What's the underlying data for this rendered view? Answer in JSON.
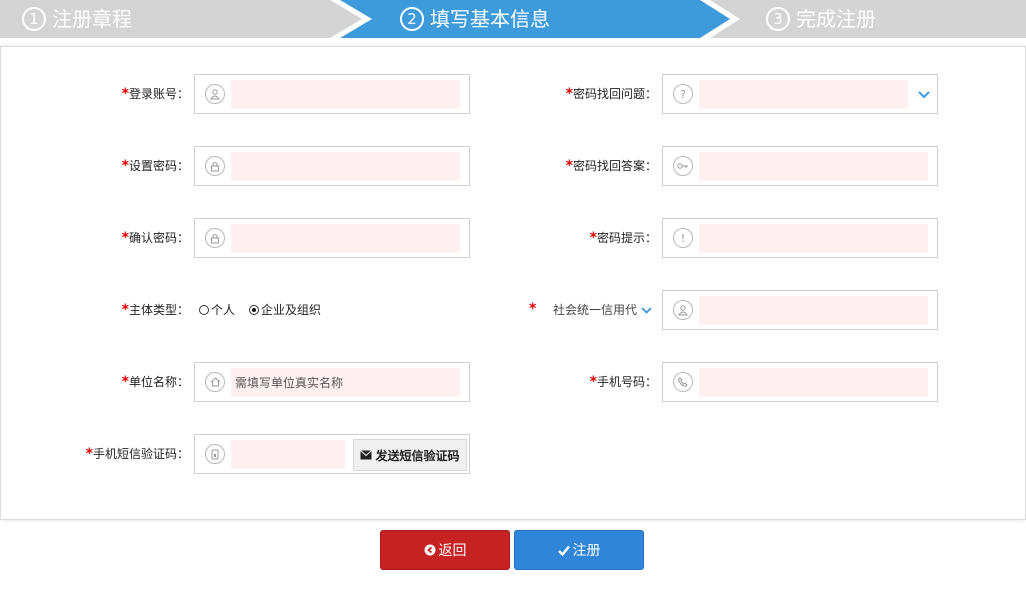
{
  "steps": [
    {
      "num": "1",
      "label": "注册章程",
      "state": "done"
    },
    {
      "num": "2",
      "label": "填写基本信息",
      "state": "active"
    },
    {
      "num": "3",
      "label": "完成注册",
      "state": "todo"
    }
  ],
  "colors": {
    "step_active": "#3d9bdc",
    "step_inactive": "#d4d4d4",
    "required": "#e00000",
    "input_bg": "#fff1f1",
    "btn_back": "#c62223",
    "btn_register": "#2f86d8"
  },
  "form": {
    "required_mark": "*",
    "login_account": {
      "label": "登录账号：",
      "value": "",
      "icon": "user-icon"
    },
    "set_password": {
      "label": "设置密码：",
      "value": "",
      "icon": "lock-icon"
    },
    "confirm_password": {
      "label": "确认密码：",
      "value": "",
      "icon": "lock-icon"
    },
    "subject_type": {
      "label": "主体类型：",
      "options": [
        "个人",
        "企业及组织"
      ],
      "selected": "企业及组织"
    },
    "org_name": {
      "label": "单位名称：",
      "placeholder": "需填写单位真实名称",
      "icon": "home-icon"
    },
    "sms_code": {
      "label": "手机短信验证码：",
      "value": "",
      "icon": "phone-card-icon",
      "send_button": "发送短信验证码"
    },
    "security_question": {
      "label": "密码找回问题：",
      "value": "",
      "icon": "question-icon"
    },
    "security_answer": {
      "label": "密码找回答案：",
      "value": "",
      "icon": "key-icon"
    },
    "password_hint": {
      "label": "密码提示：",
      "value": "",
      "icon": "exclamation-icon"
    },
    "credit_code": {
      "select_label": "社会统一信用代",
      "value": "",
      "icon": "user-icon"
    },
    "phone": {
      "label": "手机号码：",
      "value": "",
      "icon": "phone-icon"
    }
  },
  "buttons": {
    "back": "返回",
    "register": "注册"
  }
}
